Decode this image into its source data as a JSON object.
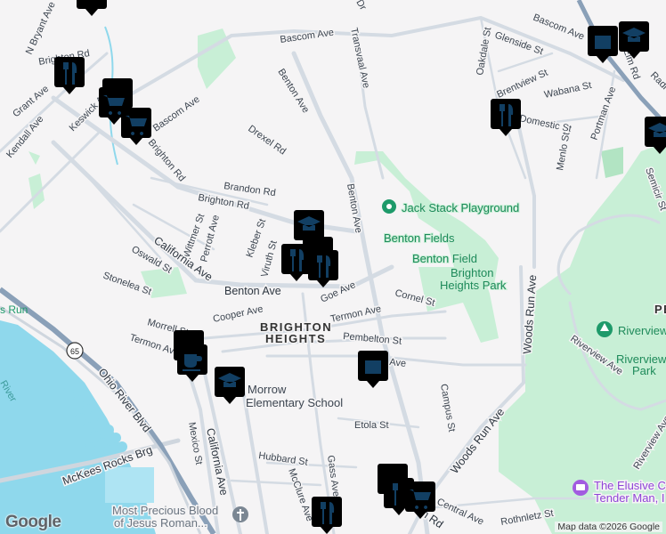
{
  "map": {
    "neighborhood": [
      "BRIGHTON",
      "HEIGHTS"
    ],
    "neighborhood_partial": "PE",
    "attribution": "Map data ©2026 Google",
    "logo": "Google",
    "route_shield": "65",
    "water": "River",
    "water_run": "s Run",
    "streets": [
      "Bascom Ave",
      "Benton Ave",
      "Transvaal Ave",
      "Bascom Ave",
      "Glenside St",
      "Oakdale St",
      "Brentview St",
      "Wabana St",
      "Domestic St",
      "Menlo St",
      "Portman Ave",
      "Radi",
      "Semicir St",
      "N Bryant Ave",
      "Brighton Rd",
      "Grant Ave",
      "Kendall Ave",
      "Keswick Ave",
      "Bascom Ave",
      "Brighton Rd",
      "Drexel Rd",
      "Brandon Rd",
      "Brighton Rd",
      "Wittmer St",
      "Perrott Ave",
      "Kleber St",
      "Viruth St",
      "California Ave",
      "Oswald St",
      "Stonelea St",
      "Benton Ave",
      "Cooper Ave",
      "Goe Ave",
      "Cornel St",
      "Termon Ave",
      "Morrell St",
      "Termon Ave",
      "Pembelton St",
      "Ave",
      "Campus St",
      "Etola St",
      "Woods Run Ave",
      "Woods Run Ave",
      "Riverview Ave",
      "Riverview Ave",
      "Ohio River Blvd",
      "McKees Rocks Brg",
      "Mexico St",
      "California Ave",
      "Hubbard St",
      "Gass Ave",
      "McClure Ave",
      "Central Ave",
      "Rothnletz St",
      "Brighton Rd",
      "Benton Ave",
      "Dr",
      "Elm Rd"
    ],
    "places": {
      "jack_stack": "Jack Stack Playground",
      "benton_fields": "Benton Fields",
      "benton_field": "Benton Field",
      "brighton_heights_park": [
        "Brighton",
        "Heights Park"
      ],
      "riverview": "Riverview",
      "riverview_park": [
        "Riverview",
        "Park"
      ],
      "morrow": [
        "Morrow",
        "Elementary School"
      ],
      "church": [
        "Most Precious Blood",
        "of Jesus Roman..."
      ],
      "elusive": [
        "The Elusive C",
        "Tender Man, I"
      ]
    },
    "markers": [
      "shopping",
      "restaurant",
      "grocery",
      "grocery",
      "shopping",
      "school",
      "restaurant",
      "school",
      "school",
      "restaurant",
      "restaurant",
      "restaurant",
      "cafe",
      "school",
      "shopping",
      "restaurant",
      "restaurant",
      "grocery",
      "restaurant"
    ],
    "colors": {
      "marker_icon": "#123f63",
      "park": "#c8efd6",
      "water": "#8fd8ec",
      "highway": "#8aa0b8"
    }
  }
}
